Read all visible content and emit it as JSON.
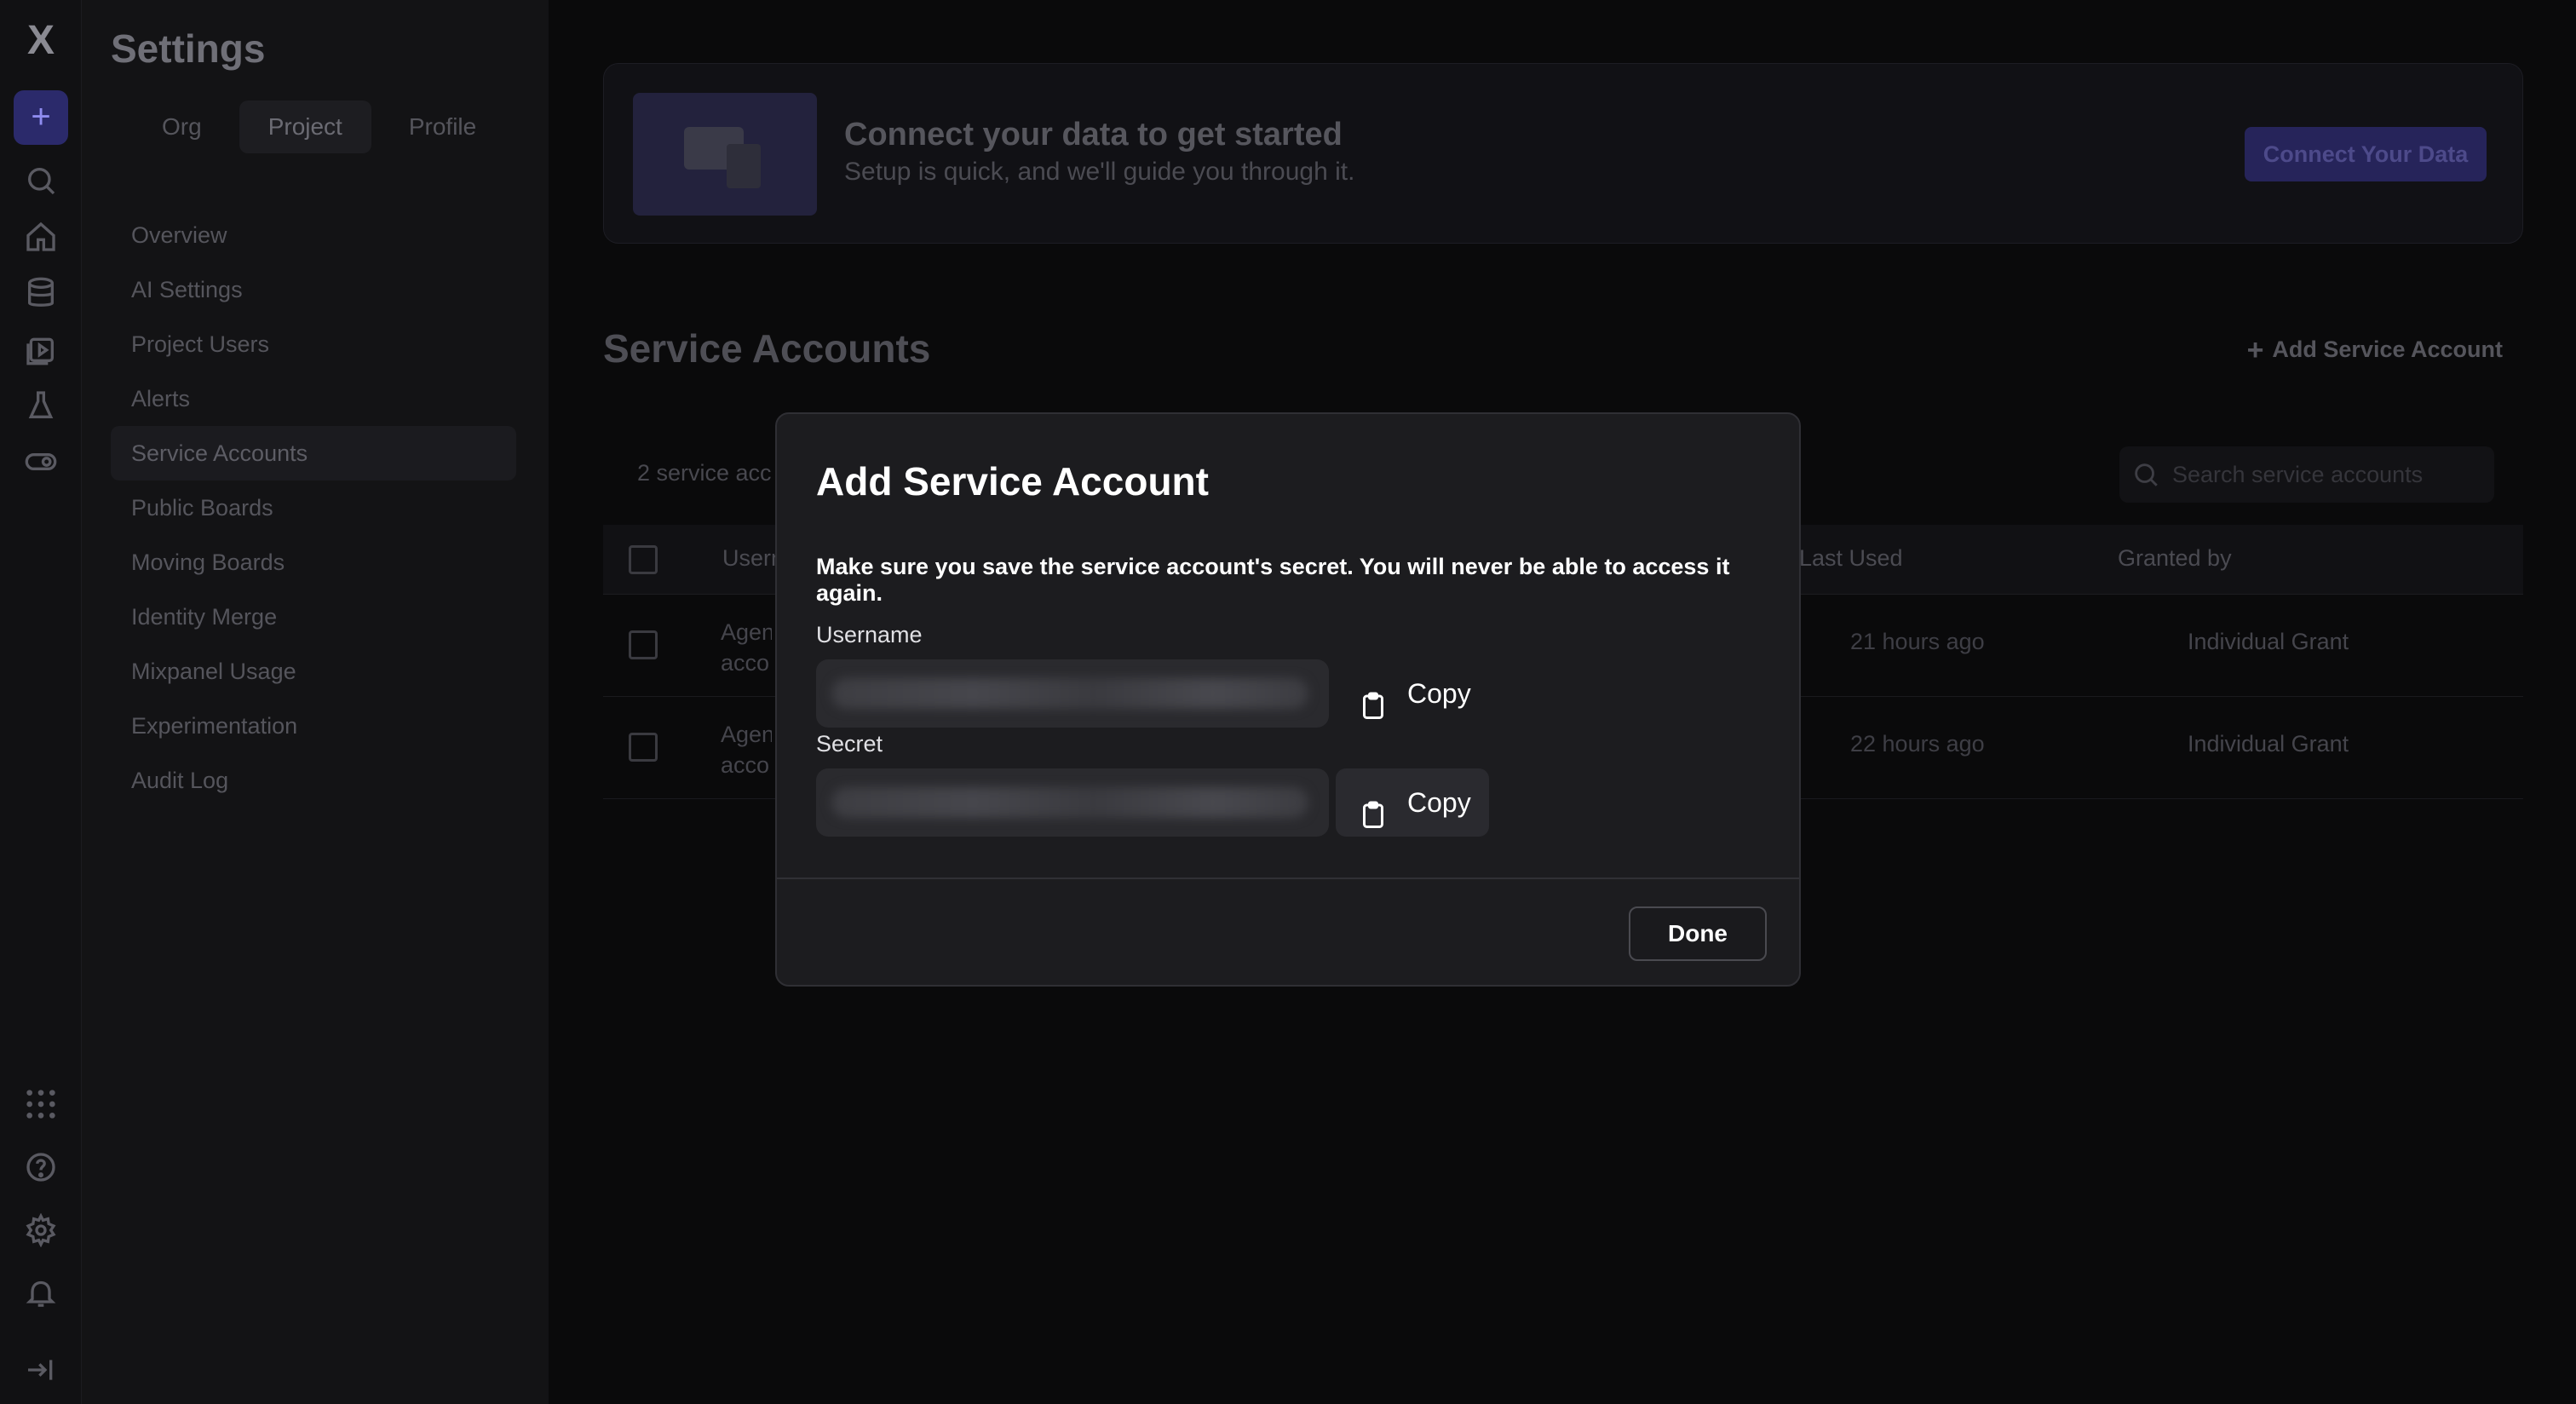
{
  "rail": {
    "logo": "X",
    "new_label": "+",
    "icons": [
      "search-icon",
      "home-icon",
      "database-icon",
      "boards-icon",
      "experiment-icon",
      "toggle-icon",
      "apps-icon",
      "help-icon",
      "gear-icon",
      "bell-icon",
      "collapse-icon"
    ]
  },
  "settings": {
    "title": "Settings",
    "tabs": [
      {
        "label": "Org"
      },
      {
        "label": "Project"
      },
      {
        "label": "Profile"
      }
    ],
    "active_tab": "Project",
    "menu": [
      {
        "label": "Overview"
      },
      {
        "label": "AI Settings"
      },
      {
        "label": "Project Users"
      },
      {
        "label": "Alerts"
      },
      {
        "label": "Service Accounts"
      },
      {
        "label": "Public Boards"
      },
      {
        "label": "Moving Boards"
      },
      {
        "label": "Identity Merge"
      },
      {
        "label": "Mixpanel Usage"
      },
      {
        "label": "Experimentation"
      },
      {
        "label": "Audit Log"
      }
    ],
    "active_menu": "Service Accounts"
  },
  "banner": {
    "heading": "Connect your data to get started",
    "subheading": "Setup is quick, and we'll guide you through it.",
    "button": "Connect Your Data"
  },
  "service_accounts": {
    "title": "Service Accounts",
    "add_button": "Add Service Account",
    "count_text": "2 service acc",
    "search_placeholder": "Search service accounts",
    "columns": {
      "username": "Usern",
      "last_used": "Last Used",
      "granted_by": "Granted by"
    },
    "rows": [
      {
        "username": "Agent acco",
        "last_used": "21 hours ago",
        "granted_by": "Individual Grant"
      },
      {
        "username": "Agent acco",
        "last_used": "22 hours ago",
        "granted_by": "Individual Grant"
      }
    ]
  },
  "modal": {
    "title": "Add Service Account",
    "warning": "Make sure you save the service account's secret. You will never be able to access it again.",
    "username_label": "Username",
    "secret_label": "Secret",
    "copy_label": "Copy",
    "done_label": "Done"
  }
}
